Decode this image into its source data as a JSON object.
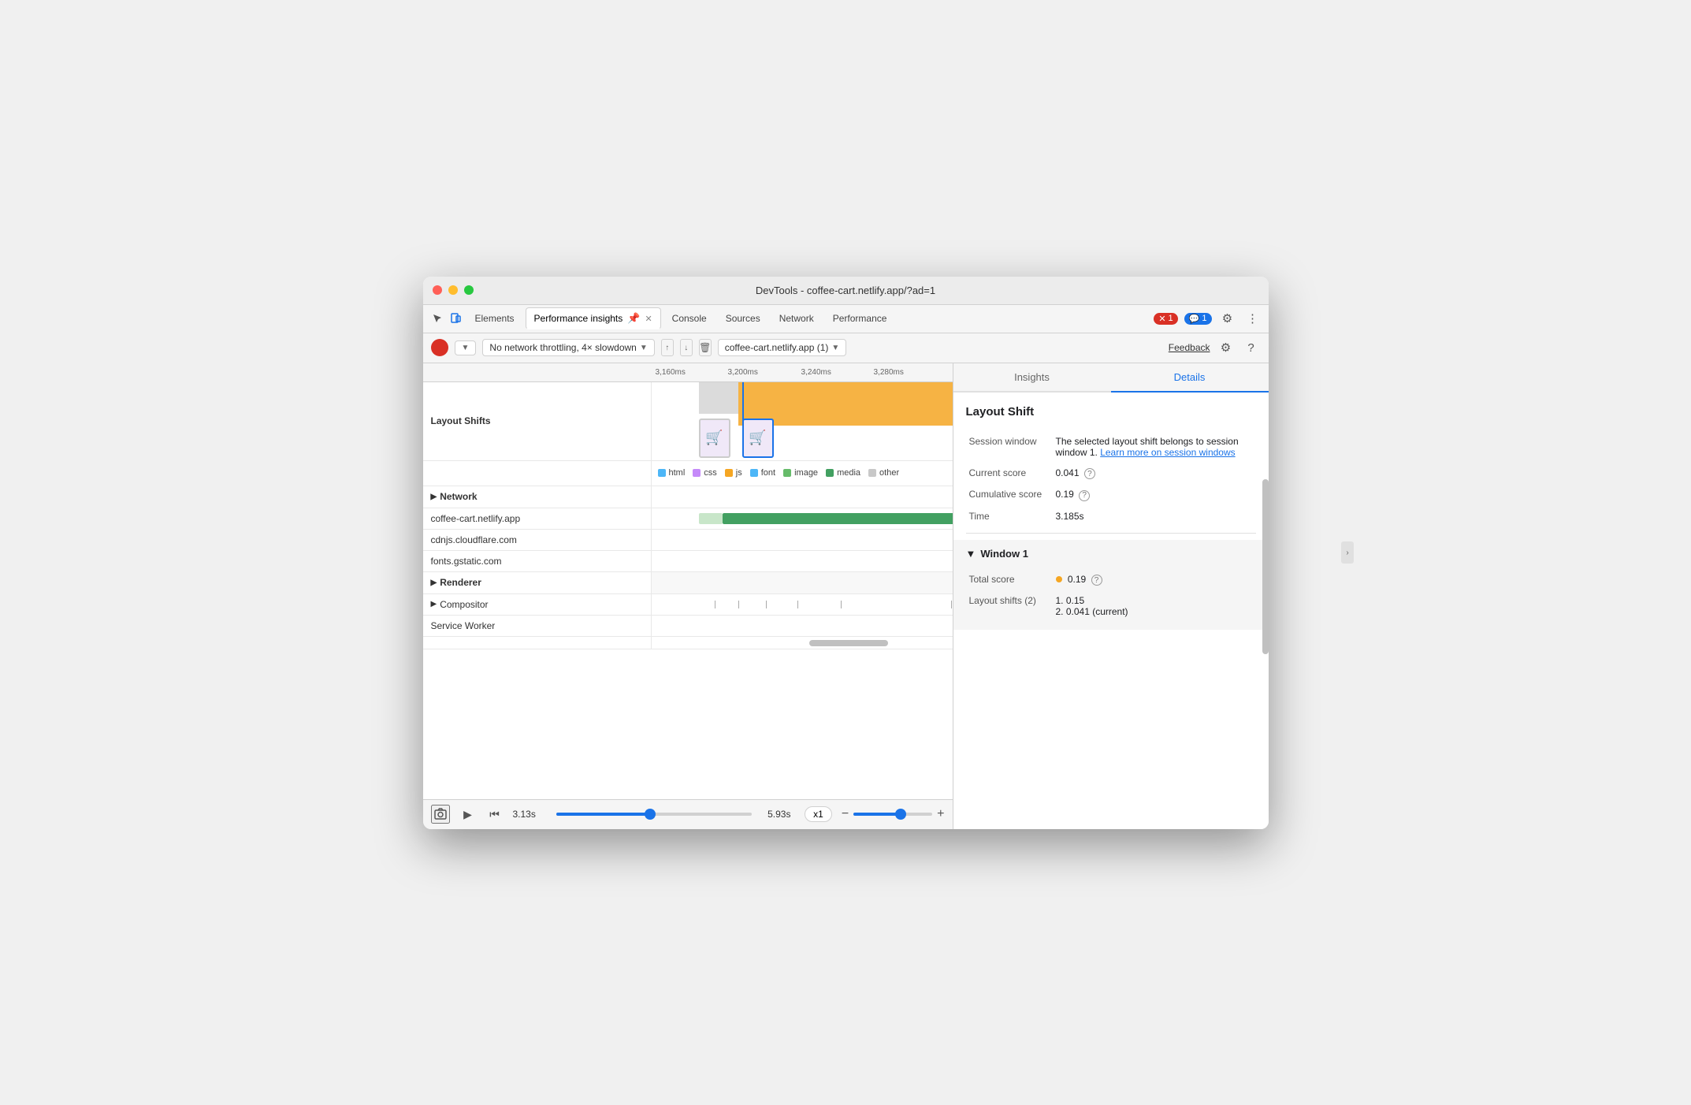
{
  "window": {
    "title": "DevTools - coffee-cart.netlify.app/?ad=1"
  },
  "tabs": {
    "items": [
      {
        "label": "Elements",
        "active": false
      },
      {
        "label": "Performance insights",
        "active": true,
        "pinned": true
      },
      {
        "label": "Console",
        "active": false
      },
      {
        "label": "Sources",
        "active": false
      },
      {
        "label": "Network",
        "active": false
      },
      {
        "label": "Performance",
        "active": false
      }
    ],
    "more": "»",
    "error_count": "1",
    "msg_count": "1"
  },
  "toolbar": {
    "throttle_label": "No network throttling, 4× slowdown",
    "site_label": "coffee-cart.netlify.app (1)",
    "feedback_label": "Feedback"
  },
  "timeline": {
    "ruler": {
      "ticks": [
        "3,160ms",
        "3,200ms",
        "3,240ms",
        "3,280ms"
      ]
    },
    "sections": {
      "layout_shifts_label": "Layout Shifts",
      "network_label": "Network",
      "network_items": [
        "coffee-cart.netlify.app",
        "cdnjs.cloudflare.com",
        "fonts.gstatic.com"
      ],
      "renderer_label": "Renderer",
      "compositor_label": "Compositor",
      "service_worker_label": "Service Worker"
    },
    "legend": {
      "items": [
        {
          "label": "html",
          "color": "#4db6f7"
        },
        {
          "label": "css",
          "color": "#c58af9"
        },
        {
          "label": "js",
          "color": "#f5a623"
        },
        {
          "label": "font",
          "color": "#4db6f7"
        },
        {
          "label": "image",
          "color": "#66bb6a"
        },
        {
          "label": "media",
          "color": "#42a061"
        },
        {
          "label": "other",
          "color": "#c8c8c8"
        }
      ]
    }
  },
  "bottom_bar": {
    "start_time": "3.13s",
    "end_time": "5.93s",
    "zoom_label": "x1"
  },
  "right_panel": {
    "tabs": [
      {
        "label": "Insights",
        "active": false
      },
      {
        "label": "Details",
        "active": true
      }
    ],
    "details": {
      "title": "Layout Shift",
      "rows": [
        {
          "label": "Session window",
          "value": "The selected layout shift belongs to session window 1.",
          "link_text": "Learn more on session windows",
          "link_url": "#"
        },
        {
          "label": "Current score",
          "value": "0.041",
          "has_help": true
        },
        {
          "label": "Cumulative score",
          "value": "0.19",
          "has_help": true
        },
        {
          "label": "Time",
          "value": "3.185s"
        }
      ],
      "window_section": {
        "title": "Window 1",
        "total_score_label": "Total score",
        "total_score_value": "0.19",
        "has_help": true,
        "layout_shifts_label": "Layout shifts (2)",
        "shift1": "1. 0.15",
        "shift2": "2. 0.041 (current)"
      }
    }
  }
}
